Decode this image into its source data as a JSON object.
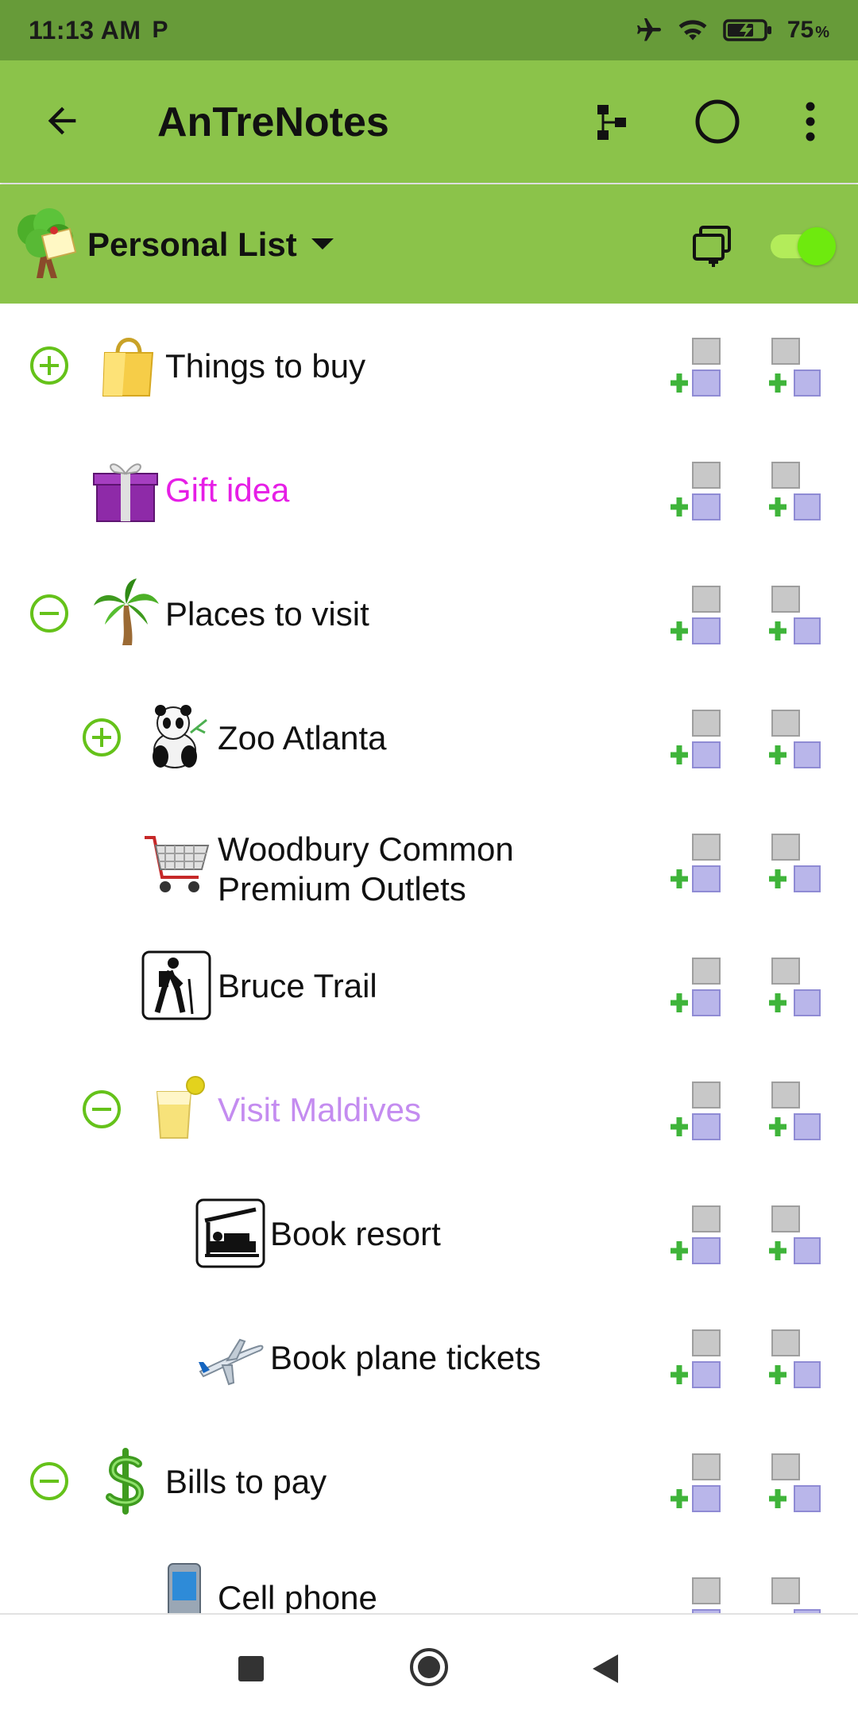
{
  "status_bar": {
    "time": "11:13 AM",
    "p_glyph": "P",
    "battery_text": "75",
    "battery_unit": "%",
    "icons": [
      "airplane-mode-icon",
      "wifi-icon",
      "battery-charging-icon"
    ]
  },
  "app_bar": {
    "title": "AnTreNotes",
    "icons": [
      "back-arrow-icon",
      "tree-structure-icon",
      "circle-icon",
      "more-vert-icon"
    ]
  },
  "list_header": {
    "title": "Personal List",
    "toggle_on": true,
    "icons": [
      "tree-logo-icon",
      "caret-down-icon",
      "copy-add-icon"
    ]
  },
  "colors": {
    "status_bar": "#679b39",
    "app_bar": "#8bc34a",
    "expander": "#65c21a",
    "gift_label": "#e61ee6",
    "maldives_label": "#c48cf0"
  },
  "tree_items": [
    {
      "label": "Things to buy",
      "icon": "shopping-bag-icon",
      "expander": "plus"
    },
    {
      "label": "Gift idea",
      "icon": "gift-icon",
      "expander": "none",
      "color": "#e61ee6"
    },
    {
      "label": "Places to visit",
      "icon": "palm-tree-icon",
      "expander": "minus"
    },
    {
      "label": "Zoo Atlanta",
      "icon": "panda-icon",
      "expander": "plus"
    },
    {
      "label": "Woodbury Common Premium Outlets",
      "icon": "shopping-cart-icon",
      "expander": "none"
    },
    {
      "label": "Bruce Trail",
      "icon": "hiker-icon",
      "expander": "none"
    },
    {
      "label": "Visit Maldives",
      "icon": "drink-icon",
      "expander": "minus",
      "color": "#c48cf0"
    },
    {
      "label": "Book resort",
      "icon": "hotel-bed-icon",
      "expander": "none"
    },
    {
      "label": "Book plane tickets",
      "icon": "airplane-icon",
      "expander": "none"
    },
    {
      "label": "Bills to pay",
      "icon": "dollar-icon",
      "expander": "minus"
    },
    {
      "label": "Cell phone",
      "icon": "cell-phone-icon",
      "expander": "none"
    }
  ],
  "row_actions": [
    "add-child-icon",
    "add-sibling-icon"
  ],
  "nav_bar": {
    "icons": [
      "recents-icon",
      "home-icon",
      "back-icon"
    ]
  }
}
